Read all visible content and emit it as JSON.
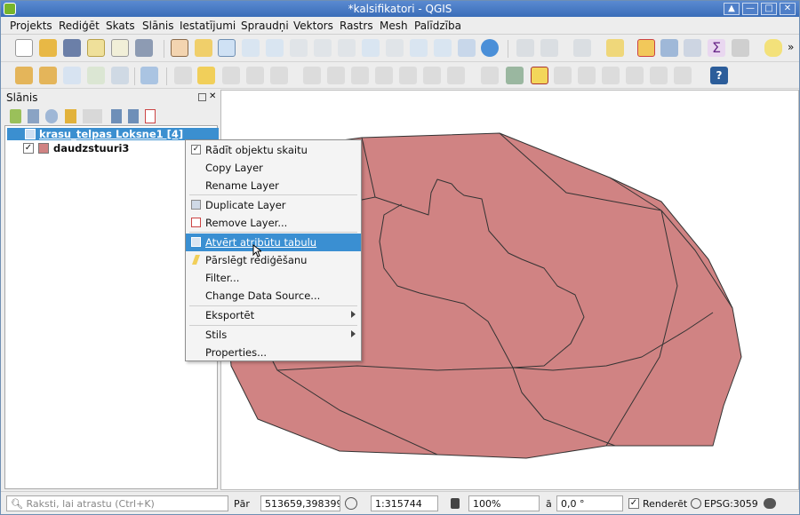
{
  "window": {
    "title": "*kalsifikatori - QGIS",
    "controls": [
      "▲",
      "—",
      "□",
      "✕"
    ]
  },
  "menubar": {
    "items": [
      "Projekts",
      "Rediģēt",
      "Skats",
      "Slānis",
      "Iestatījumi",
      "Spraudņi",
      "Vektors",
      "Rastrs",
      "Mesh",
      "Palīdzība"
    ]
  },
  "toolbar": {
    "overflow": "»"
  },
  "layers_panel": {
    "title": "Slānis",
    "layers": [
      {
        "name": "krasu_telpas Loksne1 [4]",
        "checked": false,
        "selected": true
      },
      {
        "name": "daudzstuuri3",
        "checked": true,
        "selected": false,
        "color": "#d08383"
      }
    ]
  },
  "context_menu": {
    "items": [
      {
        "label": "Rādīt objektu skaitu",
        "icon": "checkmark-icon"
      },
      {
        "label": "Copy Layer"
      },
      {
        "label": "Rename Layer"
      },
      {
        "label": "Duplicate Layer",
        "icon": "duplicate-icon"
      },
      {
        "label": "Remove Layer...",
        "icon": "remove-layer-icon"
      },
      {
        "label": "Atvērt atribūtu tabulu",
        "icon": "table-icon",
        "highlighted": true
      },
      {
        "label": "Pārslēgt rediģēšanu",
        "icon": "pencil-icon"
      },
      {
        "label": "Filter..."
      },
      {
        "label": "Change Data Source..."
      },
      {
        "label": "Eksportēt",
        "submenu": true
      },
      {
        "label": "Stils",
        "submenu": true
      },
      {
        "label": "Properties..."
      }
    ]
  },
  "map": {
    "fill_color": "#d08383",
    "stroke_color": "#333333"
  },
  "statusbar": {
    "search_placeholder": "Raksti, lai atrastu (Ctrl+K)",
    "coord_label": "Pār",
    "coordinate": "513659,398399",
    "scale_label": "",
    "scale": "1:315744",
    "magnifier": "100%",
    "rotation_label": "ā",
    "rotation": "0,0 °",
    "render_label": "Renderēt",
    "crs": "EPSG:3059"
  }
}
